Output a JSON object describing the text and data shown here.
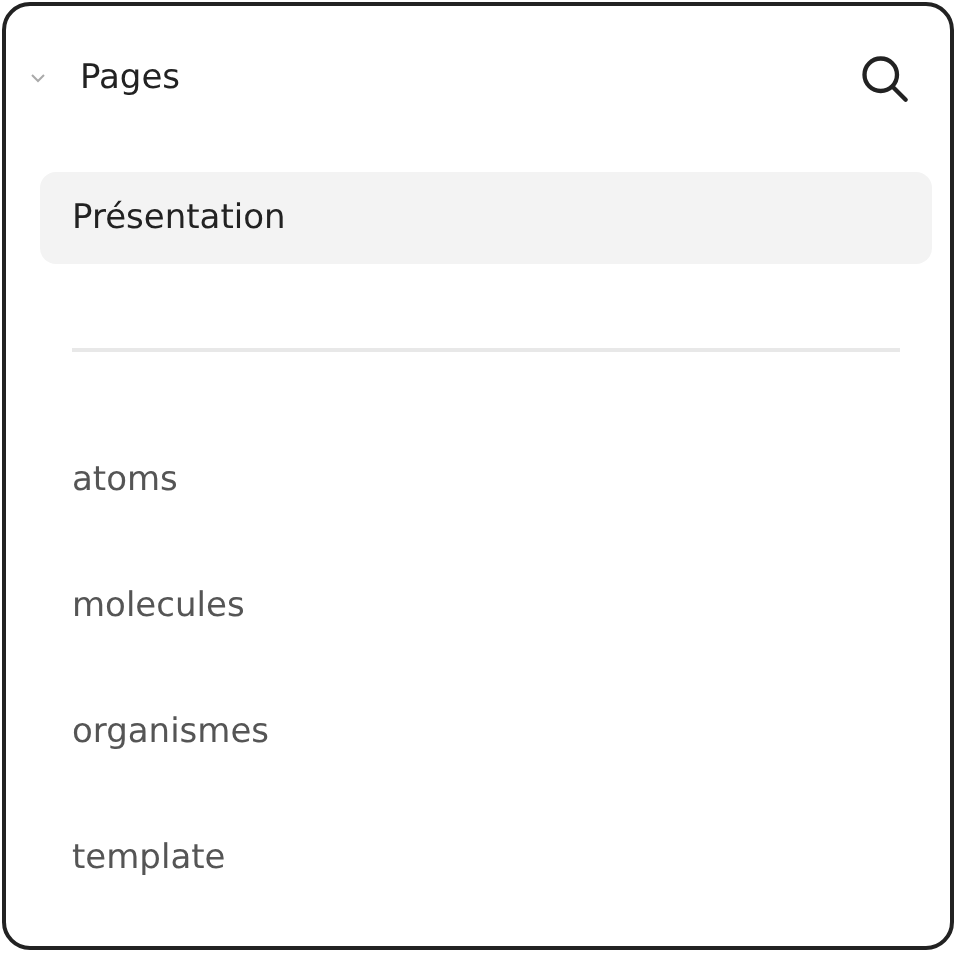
{
  "panel": {
    "title": "Pages",
    "expanded": true
  },
  "page_groups": [
    {
      "pages": [
        {
          "label": "Présentation",
          "selected": true
        }
      ]
    },
    {
      "pages": [
        {
          "label": "atoms",
          "selected": false
        },
        {
          "label": "molecules",
          "selected": false
        },
        {
          "label": "organismes",
          "selected": false
        },
        {
          "label": "template",
          "selected": false
        }
      ]
    }
  ]
}
